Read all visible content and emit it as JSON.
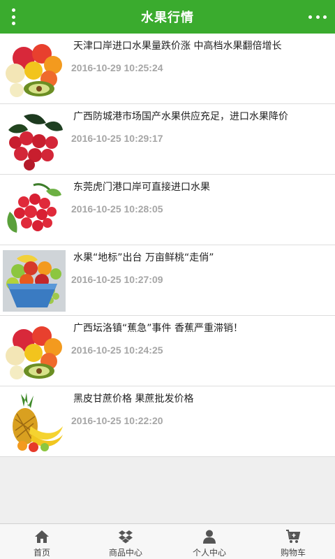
{
  "header": {
    "title": "水果行情"
  },
  "news": [
    {
      "title": "天津口岸进口水果量跌价涨 中高档水果翻倍增长",
      "date": "2016-10-29 10:25:24",
      "image": "fruit-mix-plate"
    },
    {
      "title": "广西防城港市场国产水果供应充足，进口水果降价",
      "date": "2016-10-25 10:29:17",
      "image": "cherries-with-leaves"
    },
    {
      "title": "东莞虎门港口岸可直接进口水果",
      "date": "2016-10-25 10:28:05",
      "image": "red-currants"
    },
    {
      "title": "水果“地标”出台 万亩鲜桃“走俏”",
      "date": "2016-10-25 10:27:09",
      "image": "fruit-bowl"
    },
    {
      "title": "广西坛洛镇“蕉急”事件 香蕉严重滞销！",
      "date": "2016-10-25 10:24:25",
      "image": "fruit-mix-plate"
    },
    {
      "title": "黑皮甘蔗价格 果蔗批发价格",
      "date": "2016-10-25 10:22:20",
      "image": "pineapple-banana"
    }
  ],
  "tabbar": {
    "items": [
      {
        "label": "首页",
        "icon": "home-icon"
      },
      {
        "label": "商品中心",
        "icon": "dropbox-icon"
      },
      {
        "label": "个人中心",
        "icon": "user-icon"
      },
      {
        "label": "购物车",
        "icon": "cart-icon"
      }
    ]
  },
  "colors": {
    "header_bg": "#3aab2e",
    "date_text": "#a6a6a6"
  }
}
